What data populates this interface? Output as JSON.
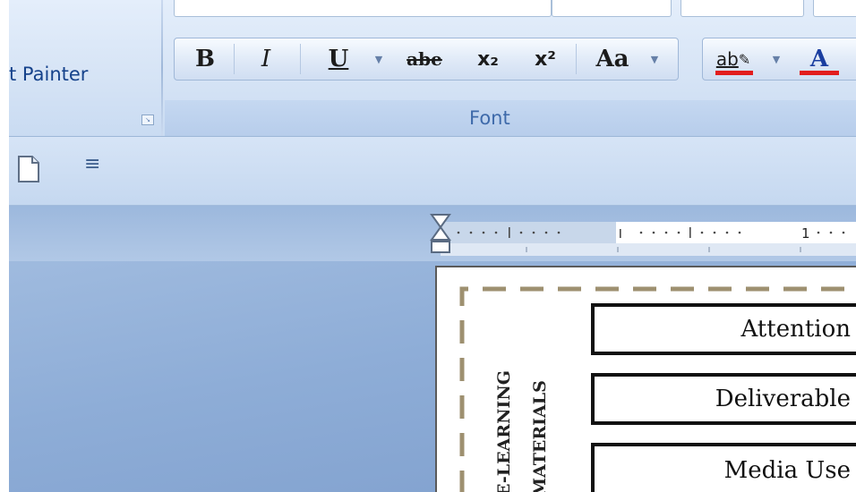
{
  "ribbon": {
    "clipboard": {
      "format_painter_label": "t Painter",
      "launcher_icon": "dialog-launcher-icon"
    },
    "font": {
      "group_label": "Font",
      "buttons": [
        {
          "name": "bold-button",
          "label": "B",
          "icon": "bold-icon"
        },
        {
          "name": "italic-button",
          "label": "I",
          "icon": "italic-icon"
        },
        {
          "name": "underline-button",
          "label": "U",
          "icon": "underline-icon"
        },
        {
          "name": "strikethrough-button",
          "label": "abe",
          "icon": "strikethrough-icon"
        },
        {
          "name": "subscript-button",
          "label": "x₂",
          "icon": "subscript-icon"
        },
        {
          "name": "superscript-button",
          "label": "x²",
          "icon": "superscript-icon"
        },
        {
          "name": "change-case-button",
          "label": "Aa",
          "icon": "change-case-icon"
        },
        {
          "name": "highlight-button",
          "label": "ab",
          "icon": "text-highlight-icon",
          "color": "#e21d1d"
        },
        {
          "name": "font-color-button",
          "label": "A",
          "icon": "font-color-icon",
          "color": "#e21d1d"
        }
      ]
    }
  },
  "quick_access": {
    "new_document_icon": "new-document-icon",
    "customize_icon": "customize-quick-access-icon"
  },
  "ruler": {
    "visible_number": "1"
  },
  "document": {
    "vertical_heading_lines": [
      "E-LEARNING",
      "MATERIALS"
    ],
    "items": [
      "Attention",
      "Deliverable",
      "Media Use"
    ]
  },
  "colors": {
    "accent_red": "#e21d1d",
    "ribbon_text": "#15428b",
    "dashed_border": "#9e9070"
  }
}
